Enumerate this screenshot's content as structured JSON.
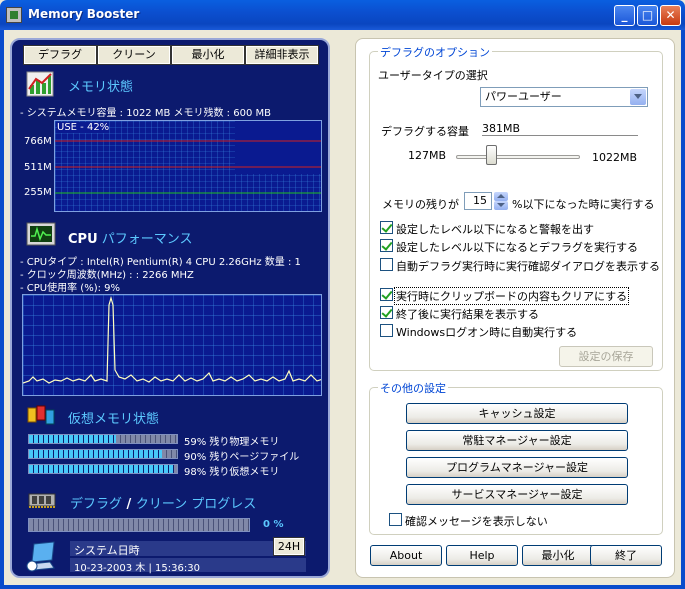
{
  "window": {
    "title": "Memory Booster"
  },
  "left": {
    "buttons": {
      "defrag": "デフラグ",
      "clean": "クリーン",
      "minimize": "最小化",
      "details": "詳細非表示"
    },
    "memory": {
      "title": "メモリ状態",
      "info": "- システムメモリ容量 : 1022 MB  メモリ残数 : 600 MB",
      "use_label": "USE - 42%",
      "use_percent": 42,
      "ticks": [
        "766M",
        "511M",
        "255M"
      ]
    },
    "cpu": {
      "title_strong": "CPU",
      "title_rest": " パフォーマンス",
      "type": "- CPUタイプ : Intel(R) Pentium(R) 4 CPU 2.26GHz 数量 : 1",
      "clock": "- クロック周波数(MHz) : : 2266 MHZ",
      "usage": "- CPU使用率 (%):  9%"
    },
    "virtual": {
      "title": "仮想メモリ状態",
      "rows": [
        {
          "label": "59% 残り物理メモリ",
          "percent": 59
        },
        {
          "label": "90% 残りページファイル",
          "percent": 90
        },
        {
          "label": "98% 残り仮想メモリ",
          "percent": 98
        }
      ]
    },
    "progress": {
      "title_a": "デフラグ",
      "title_sep": " / ",
      "title_b": "クリーン  プログレス",
      "value": "0 %",
      "percent": 0
    },
    "clock": {
      "label": "システム日時",
      "value": "10-23-2003 木 | 15:36:30",
      "mode_button": "24H"
    }
  },
  "right": {
    "defrag_options": {
      "title": "デフラグのオプション",
      "user_type_label": "ユーザータイプの選択",
      "user_type_value": "パワーユーザー",
      "capacity_label": "デフラグする容量",
      "capacity_value": "381MB",
      "slider_min": "127MB",
      "slider_max": "1022MB",
      "slider_value_mb": 381,
      "remaining_label": "メモリの残りが",
      "remaining_value": "15",
      "remaining_suffix": "%以下になった時に実行する",
      "checks": [
        {
          "label": "設定したレベル以下になると警報を出す",
          "checked": true
        },
        {
          "label": "設定したレベル以下になるとデフラグを実行する",
          "checked": true
        },
        {
          "label": "自動デフラグ実行時に実行確認ダイアログを表示する",
          "checked": false
        },
        {
          "label": "実行時にクリップボードの内容もクリアにする",
          "checked": true
        },
        {
          "label": "終了後に実行結果を表示する",
          "checked": true
        },
        {
          "label": "Windowsログオン時に自動実行する",
          "checked": false
        }
      ],
      "save_button": "設定の保存"
    },
    "other_settings": {
      "title": "その他の設定",
      "buttons": [
        "キャッシュ設定",
        "常駐マネージャー設定",
        "プログラムマネージャー設定",
        "サービスマネージャー設定"
      ],
      "confirm_label": "確認メッセージを表示しない",
      "confirm_checked": false
    },
    "footer": {
      "about": "About",
      "help": "Help",
      "minimize": "最小化",
      "exit": "終了"
    }
  }
}
